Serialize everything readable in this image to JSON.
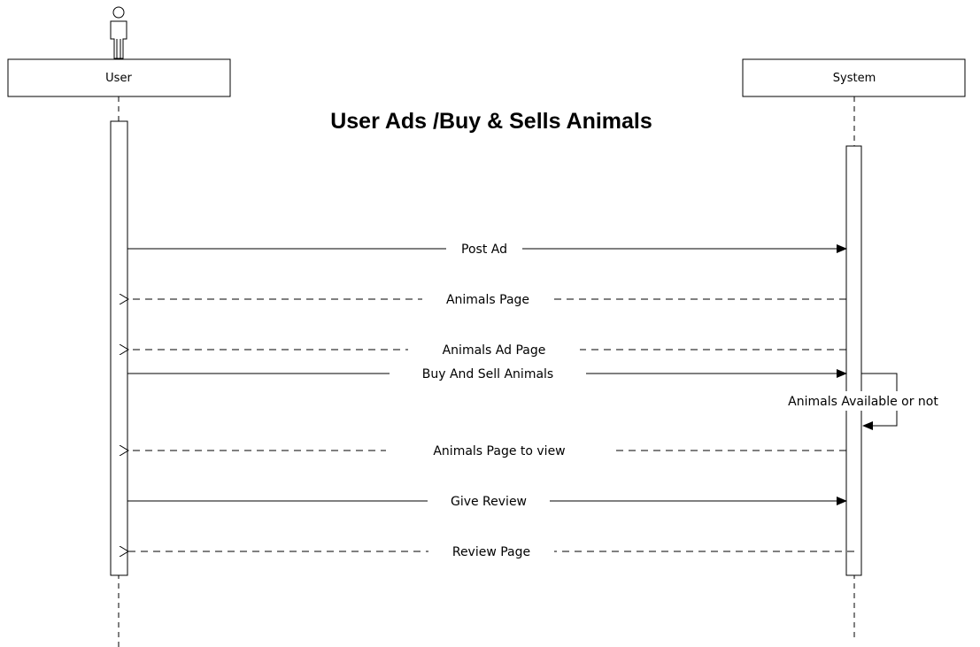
{
  "title": "User Ads /Buy & Sells Animals",
  "lifelines": {
    "user": {
      "label": "User"
    },
    "system": {
      "label": "System"
    }
  },
  "messages": [
    {
      "label": "Post Ad",
      "from": "user",
      "to": "system",
      "kind": "sync"
    },
    {
      "label": "Animals Page",
      "from": "system",
      "to": "user",
      "kind": "return"
    },
    {
      "label": "Animals Ad Page",
      "from": "system",
      "to": "user",
      "kind": "return"
    },
    {
      "label": "Buy And Sell Animals",
      "from": "user",
      "to": "system",
      "kind": "sync"
    },
    {
      "label": "Animals Available or not",
      "from": "system",
      "to": "system",
      "kind": "self"
    },
    {
      "label": "Animals Page to view",
      "from": "system",
      "to": "user",
      "kind": "return"
    },
    {
      "label": "Give Review",
      "from": "user",
      "to": "system",
      "kind": "sync"
    },
    {
      "label": "Review Page",
      "from": "system",
      "to": "user",
      "kind": "return"
    }
  ]
}
